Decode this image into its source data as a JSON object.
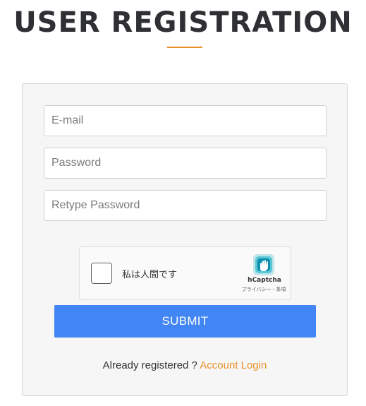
{
  "header": {
    "title": "USER REGISTRATION"
  },
  "form": {
    "email_placeholder": "E-mail",
    "password_placeholder": "Password",
    "retype_password_placeholder": "Retype Password",
    "submit_label": "SUBMIT"
  },
  "captcha": {
    "label": "私は人間です",
    "brand": "hCaptcha",
    "links": "プライバシー - 条項",
    "checked": false
  },
  "footer": {
    "prompt_text": "Already registered ?",
    "login_link": "Account Login"
  },
  "colors": {
    "accent": "#e8912a",
    "submit": "#4285f4",
    "title": "#2f3034"
  },
  "icons": {
    "captcha_logo": "hcaptcha-logo-icon"
  }
}
